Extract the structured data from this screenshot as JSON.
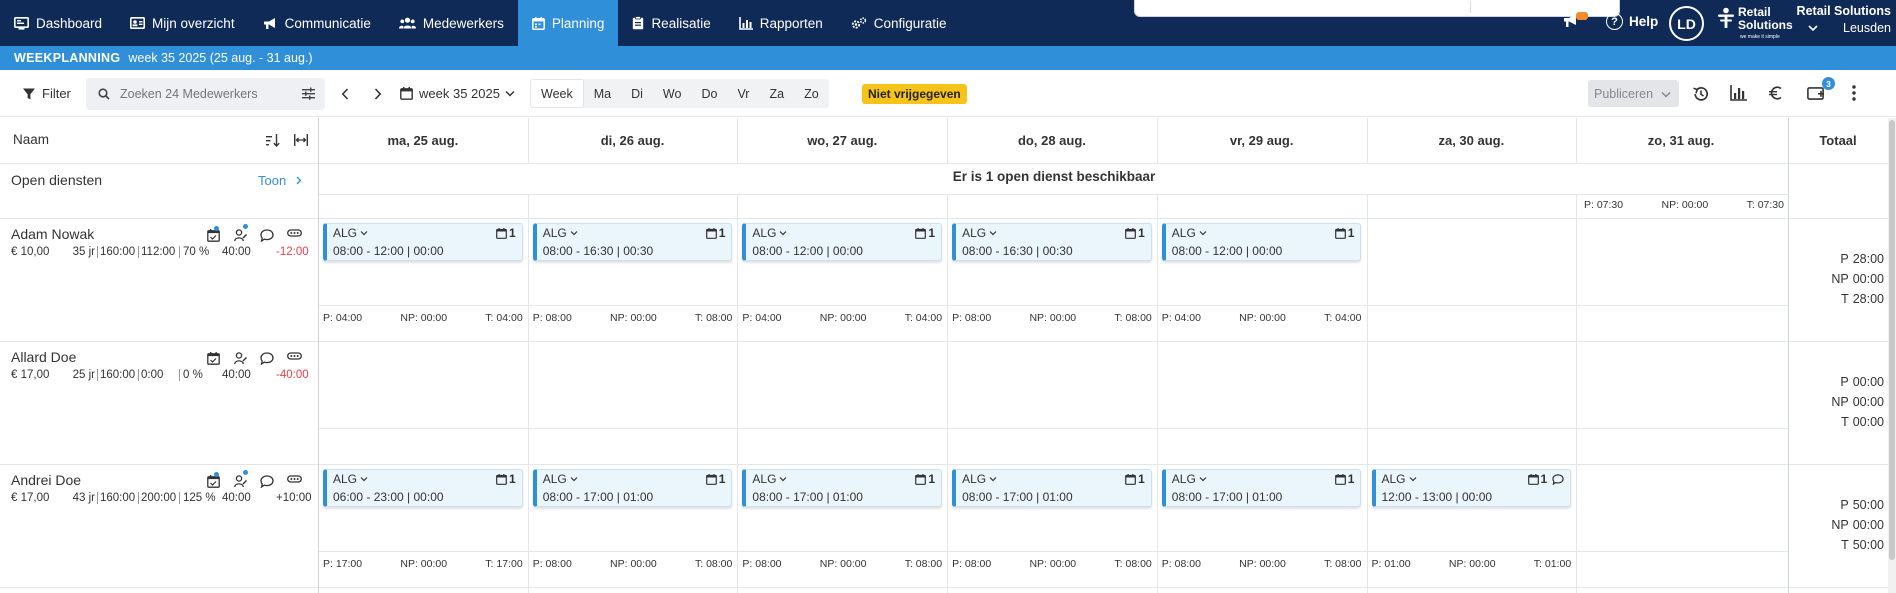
{
  "nav": {
    "items": [
      {
        "label": "Dashboard",
        "icon": "dashboard-icon"
      },
      {
        "label": "Mijn overzicht",
        "icon": "id-card-icon"
      },
      {
        "label": "Communicatie",
        "icon": "megaphone-icon"
      },
      {
        "label": "Medewerkers",
        "icon": "people-icon"
      },
      {
        "label": "Planning",
        "icon": "calendar-icon",
        "active": true
      },
      {
        "label": "Realisatie",
        "icon": "clipboard-icon"
      },
      {
        "label": "Rapporten",
        "icon": "bar-chart-icon"
      },
      {
        "label": "Configuratie",
        "icon": "gears-icon"
      }
    ],
    "help_label": "Help",
    "avatar_initials": "LD",
    "brand_line1": "Retail",
    "brand_line2": "Solutions",
    "brand_tagline": "we make it simple",
    "org_name": "Retail Solutions",
    "org_location": "Leusden"
  },
  "banner": {
    "title": "WEEKPLANNING",
    "week_label": "week 35 2025 (25 aug. - 31 aug.)"
  },
  "toolbar": {
    "filter_label": "Filter",
    "search_placeholder": "Zoeken 24 Medewerkers",
    "week_selector": "week 35 2025",
    "view_week": "Week",
    "days": [
      "Ma",
      "Di",
      "Wo",
      "Do",
      "Vr",
      "Za",
      "Zo"
    ],
    "status": "Niet vrijgegeven",
    "publish_label": "Publiceren",
    "notifications_count": "3"
  },
  "grid": {
    "name_header": "Naam",
    "total_header": "Totaal",
    "day_headers": [
      "ma, 25 aug.",
      "di, 26 aug.",
      "wo, 27 aug.",
      "do, 28 aug.",
      "vr, 29 aug.",
      "za, 30 aug.",
      "zo, 31 aug."
    ],
    "open": {
      "label": "Open diensten",
      "toon": "Toon",
      "message": "Er is 1 open dienst beschikbaar",
      "sums": [
        "P: 07:30",
        "NP: 00:00",
        "T: 07:30"
      ]
    },
    "employees": [
      {
        "name": "Adam Nowak",
        "wage": "€ 10,00",
        "age": "35 jr",
        "contract": "160:00",
        "planned": "112:00",
        "percent": "70 %",
        "hours": "40:00",
        "diff": "-12:00",
        "totals": {
          "P": "28:00",
          "NP": "00:00",
          "T": "28:00"
        },
        "shifts": [
          {
            "code": "ALG",
            "time": "08:00 - 12:00 | 00:00",
            "count": "1"
          },
          {
            "code": "ALG",
            "time": "08:00 - 16:30 | 00:30",
            "count": "1"
          },
          {
            "code": "ALG",
            "time": "08:00 - 12:00 | 00:00",
            "count": "1"
          },
          {
            "code": "ALG",
            "time": "08:00 - 16:30 | 00:30",
            "count": "1"
          },
          {
            "code": "ALG",
            "time": "08:00 - 12:00 | 00:00",
            "count": "1"
          },
          null,
          null
        ],
        "day_sums": [
          [
            "P: 04:00",
            "NP: 00:00",
            "T: 04:00"
          ],
          [
            "P: 08:00",
            "NP: 00:00",
            "T: 08:00"
          ],
          [
            "P: 04:00",
            "NP: 00:00",
            "T: 04:00"
          ],
          [
            "P: 08:00",
            "NP: 00:00",
            "T: 08:00"
          ],
          [
            "P: 04:00",
            "NP: 00:00",
            "T: 04:00"
          ],
          null,
          null
        ]
      },
      {
        "name": "Allard Doe",
        "wage": "€ 17,00",
        "age": "25 jr",
        "contract": "160:00",
        "planned": "0:00",
        "percent": "0 %",
        "hours": "40:00",
        "diff": "-40:00",
        "totals": {
          "P": "00:00",
          "NP": "00:00",
          "T": "00:00"
        },
        "shifts": [
          null,
          null,
          null,
          null,
          null,
          null,
          null
        ],
        "day_sums": [
          null,
          null,
          null,
          null,
          null,
          null,
          null
        ]
      },
      {
        "name": "Andrei Doe",
        "wage": "€ 17,00",
        "age": "43 jr",
        "contract": "160:00",
        "planned": "200:00",
        "percent": "125 %",
        "hours": "40:00",
        "diff": "+10:00",
        "totals": {
          "P": "50:00",
          "NP": "00:00",
          "T": "50:00"
        },
        "shifts": [
          {
            "code": "ALG",
            "time": "06:00 - 23:00 | 00:00",
            "count": "1"
          },
          {
            "code": "ALG",
            "time": "08:00 - 17:00 | 01:00",
            "count": "1"
          },
          {
            "code": "ALG",
            "time": "08:00 - 17:00 | 01:00",
            "count": "1"
          },
          {
            "code": "ALG",
            "time": "08:00 - 17:00 | 01:00",
            "count": "1"
          },
          {
            "code": "ALG",
            "time": "08:00 - 17:00 | 01:00",
            "count": "1"
          },
          {
            "code": "ALG",
            "time": "12:00 - 13:00 | 00:00",
            "count": "1",
            "comment": true
          },
          null
        ],
        "day_sums": [
          [
            "P: 17:00",
            "NP: 00:00",
            "T: 17:00"
          ],
          [
            "P: 08:00",
            "NP: 00:00",
            "T: 08:00"
          ],
          [
            "P: 08:00",
            "NP: 00:00",
            "T: 08:00"
          ],
          [
            "P: 08:00",
            "NP: 00:00",
            "T: 08:00"
          ],
          [
            "P: 08:00",
            "NP: 00:00",
            "T: 08:00"
          ],
          [
            "P: 01:00",
            "NP: 00:00",
            "T: 01:00"
          ],
          null
        ]
      }
    ]
  },
  "colors": {
    "nav_bg": "#0f2a57",
    "accent": "#2f8fd8",
    "status_yellow": "#f6c419",
    "negative": "#e2434b",
    "shift_bg": "#eaf5fc"
  }
}
